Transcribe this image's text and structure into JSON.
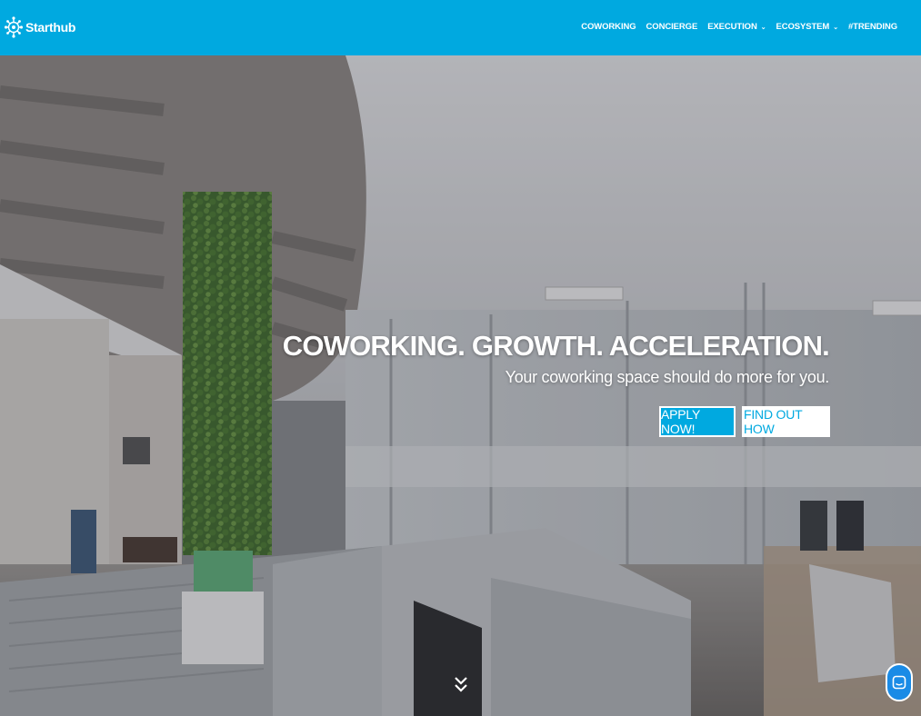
{
  "brand": {
    "name": "Starthub",
    "color": "#00a9e0"
  },
  "nav": {
    "items": [
      {
        "label": "COWORKING",
        "has_dropdown": false
      },
      {
        "label": "CONCIERGE",
        "has_dropdown": false
      },
      {
        "label": "EXECUTION",
        "has_dropdown": true
      },
      {
        "label": "ECOSYSTEM",
        "has_dropdown": true
      },
      {
        "label": "#TRENDING",
        "has_dropdown": false
      }
    ],
    "dropdown_icon": "chevron-down-icon"
  },
  "hero": {
    "title": "COWORKING. GROWTH. ACCELERATION.",
    "subtitle": "Your coworking space should do more for you.",
    "apply_label": "APPLY NOW!",
    "find_label": "FIND OUT HOW",
    "scroll_icon": "double-chevron-down-icon",
    "background": "coworking office interior photo"
  },
  "chat": {
    "icon": "chat-icon",
    "color": "#1a8be6"
  }
}
